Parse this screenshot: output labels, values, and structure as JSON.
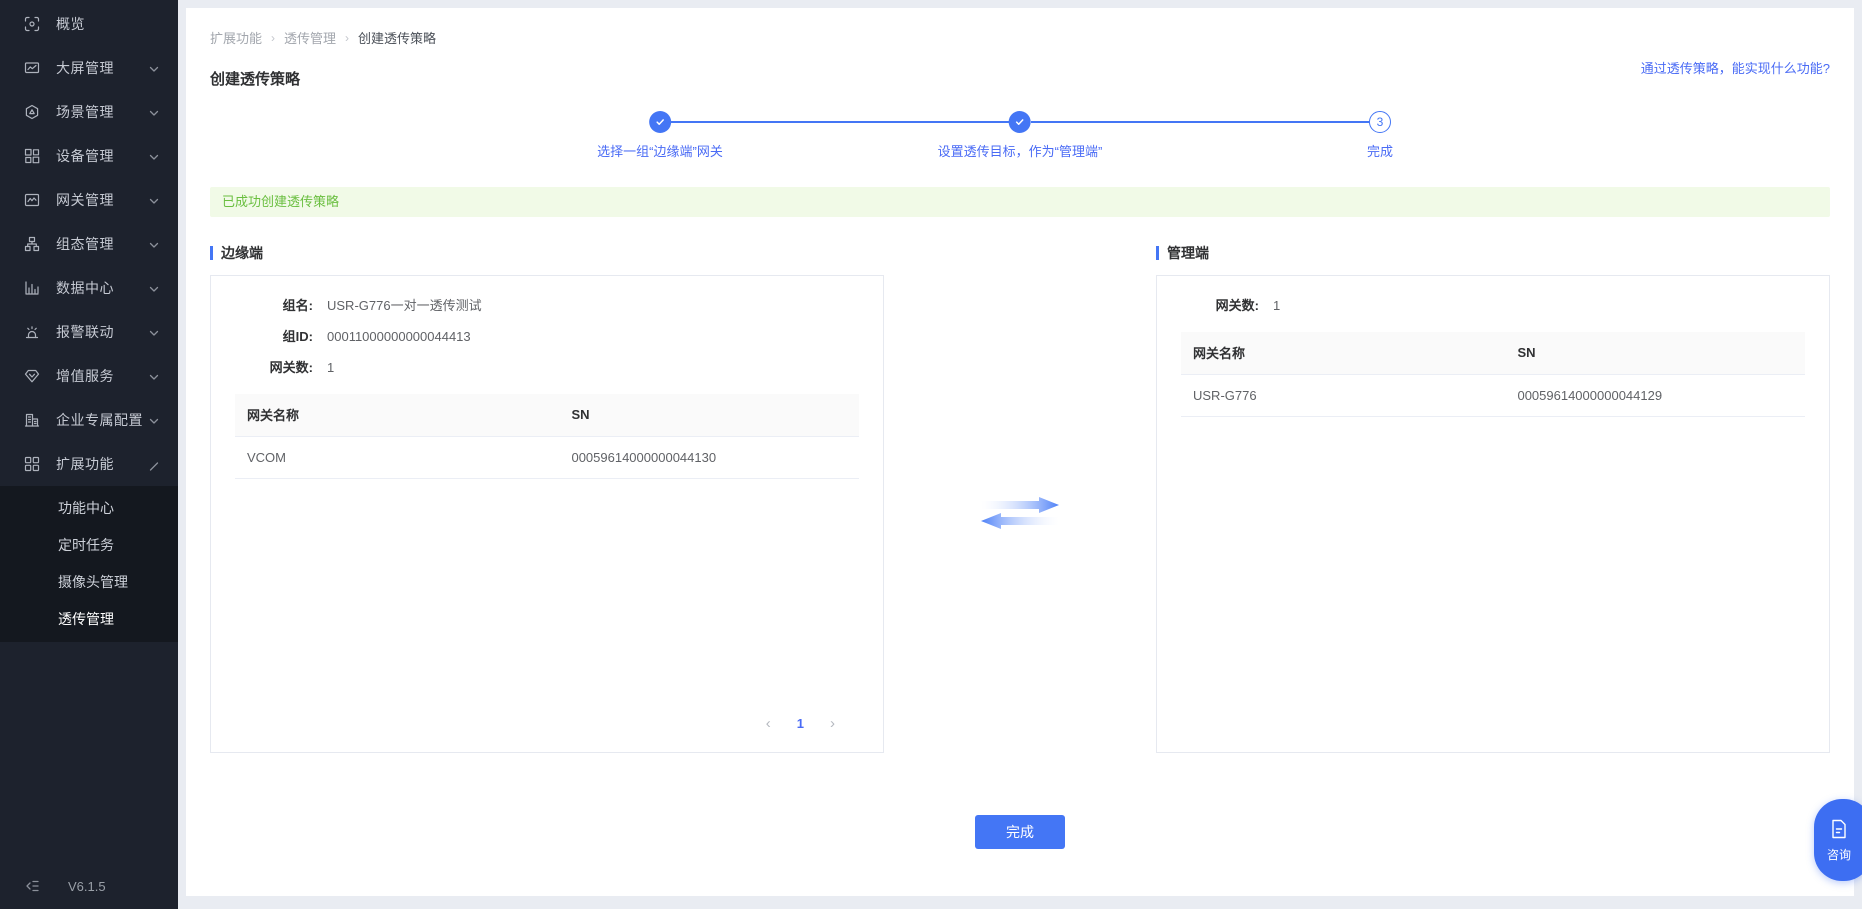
{
  "colors": {
    "accent": "#4476f5",
    "link": "#4a6bf5",
    "success_text": "#6abf40",
    "success_bg": "#f1fae7",
    "sidebar_bg": "#1d222d",
    "submenu_bg": "#14181f",
    "page_bg": "#e9ecf2"
  },
  "sidebar": {
    "version": "V6.1.5",
    "items": [
      {
        "key": "overview",
        "label": "概览",
        "icon": "overview-icon",
        "chevron": null
      },
      {
        "key": "screen",
        "label": "大屏管理",
        "icon": "screen-icon",
        "chevron": "down"
      },
      {
        "key": "scene",
        "label": "场景管理",
        "icon": "scene-icon",
        "chevron": "down"
      },
      {
        "key": "device",
        "label": "设备管理",
        "icon": "device-icon",
        "chevron": "down"
      },
      {
        "key": "gateway",
        "label": "网关管理",
        "icon": "gateway-icon",
        "chevron": "down"
      },
      {
        "key": "config",
        "label": "组态管理",
        "icon": "config-icon",
        "chevron": "down"
      },
      {
        "key": "data",
        "label": "数据中心",
        "icon": "data-icon",
        "chevron": "down"
      },
      {
        "key": "alarm",
        "label": "报警联动",
        "icon": "alarm-icon",
        "chevron": "down"
      },
      {
        "key": "vas",
        "label": "增值服务",
        "icon": "vas-icon",
        "chevron": "down"
      },
      {
        "key": "enterprise",
        "label": "企业专属配置",
        "icon": "enterprise-icon",
        "chevron": "down"
      },
      {
        "key": "extension",
        "label": "扩展功能",
        "icon": "extension-icon",
        "chevron": "up"
      }
    ],
    "submenu": {
      "items": [
        {
          "key": "feature-center",
          "label": "功能中心",
          "active": false
        },
        {
          "key": "scheduled-tasks",
          "label": "定时任务",
          "active": false
        },
        {
          "key": "camera-management",
          "label": "摄像头管理",
          "active": false
        },
        {
          "key": "passthrough-management",
          "label": "透传管理",
          "active": true
        }
      ]
    }
  },
  "breadcrumb": {
    "separator": "›",
    "items": [
      "扩展功能",
      "透传管理",
      "创建透传策略"
    ]
  },
  "page": {
    "title": "创建透传策略",
    "help_link": "通过透传策略，能实现什么功能?"
  },
  "stepper": {
    "steps": [
      {
        "state": "done",
        "number": "1",
        "label": "选择一组“边缘端”网关"
      },
      {
        "state": "done",
        "number": "2",
        "label": "设置透传目标，作为“管理端”"
      },
      {
        "state": "current",
        "number": "3",
        "label": "完成"
      }
    ]
  },
  "alert": {
    "text": "已成功创建透传策略"
  },
  "edge_panel": {
    "title": "边缘端",
    "fields": [
      {
        "label": "组名:",
        "value": "USR-G776一对一透传测试"
      },
      {
        "label": "组ID:",
        "value": "00011000000000044413"
      },
      {
        "label": "网关数:",
        "value": "1"
      }
    ],
    "table": {
      "headers": [
        "网关名称",
        "SN"
      ],
      "rows": [
        [
          "VCOM",
          "00059614000000044130"
        ]
      ]
    },
    "pagination": {
      "prev": "‹",
      "page": "1",
      "next": "›"
    }
  },
  "manage_panel": {
    "title": "管理端",
    "fields": [
      {
        "label": "网关数:",
        "value": "1"
      }
    ],
    "table": {
      "headers": [
        "网关名称",
        "SN"
      ],
      "rows": [
        [
          "USR-G776",
          "00059614000000044129"
        ]
      ]
    }
  },
  "footer": {
    "finish_label": "完成"
  },
  "floating": {
    "consult_label": "咨询"
  }
}
